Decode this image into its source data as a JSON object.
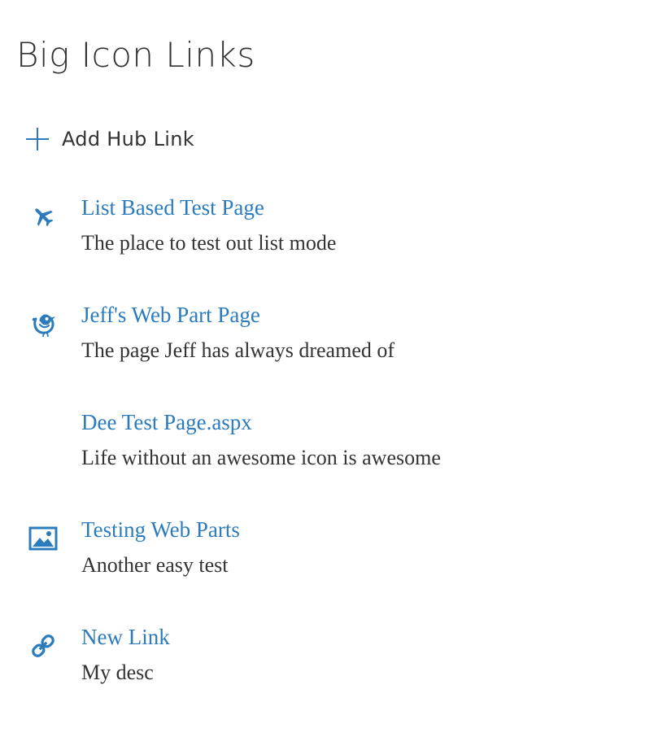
{
  "header": {
    "title": "Big Icon Links"
  },
  "toolbar": {
    "add_label": "Add Hub Link",
    "add_icon": "plus-icon"
  },
  "colors": {
    "accent": "#2b7bbd",
    "text": "#333333"
  },
  "links": [
    {
      "title": "List Based Test Page",
      "description": "The place to test out list mode",
      "icon": "airplane-icon"
    },
    {
      "title": "Jeff's Web Part Page",
      "description": "The page Jeff has always dreamed of",
      "icon": "bird-icon"
    },
    {
      "title": "Dee Test Page.aspx",
      "description": "Life without an awesome icon is awesome",
      "icon": ""
    },
    {
      "title": "Testing Web Parts",
      "description": "Another easy test",
      "icon": "picture-icon"
    },
    {
      "title": "New Link",
      "description": "My desc",
      "icon": "link-icon"
    }
  ]
}
